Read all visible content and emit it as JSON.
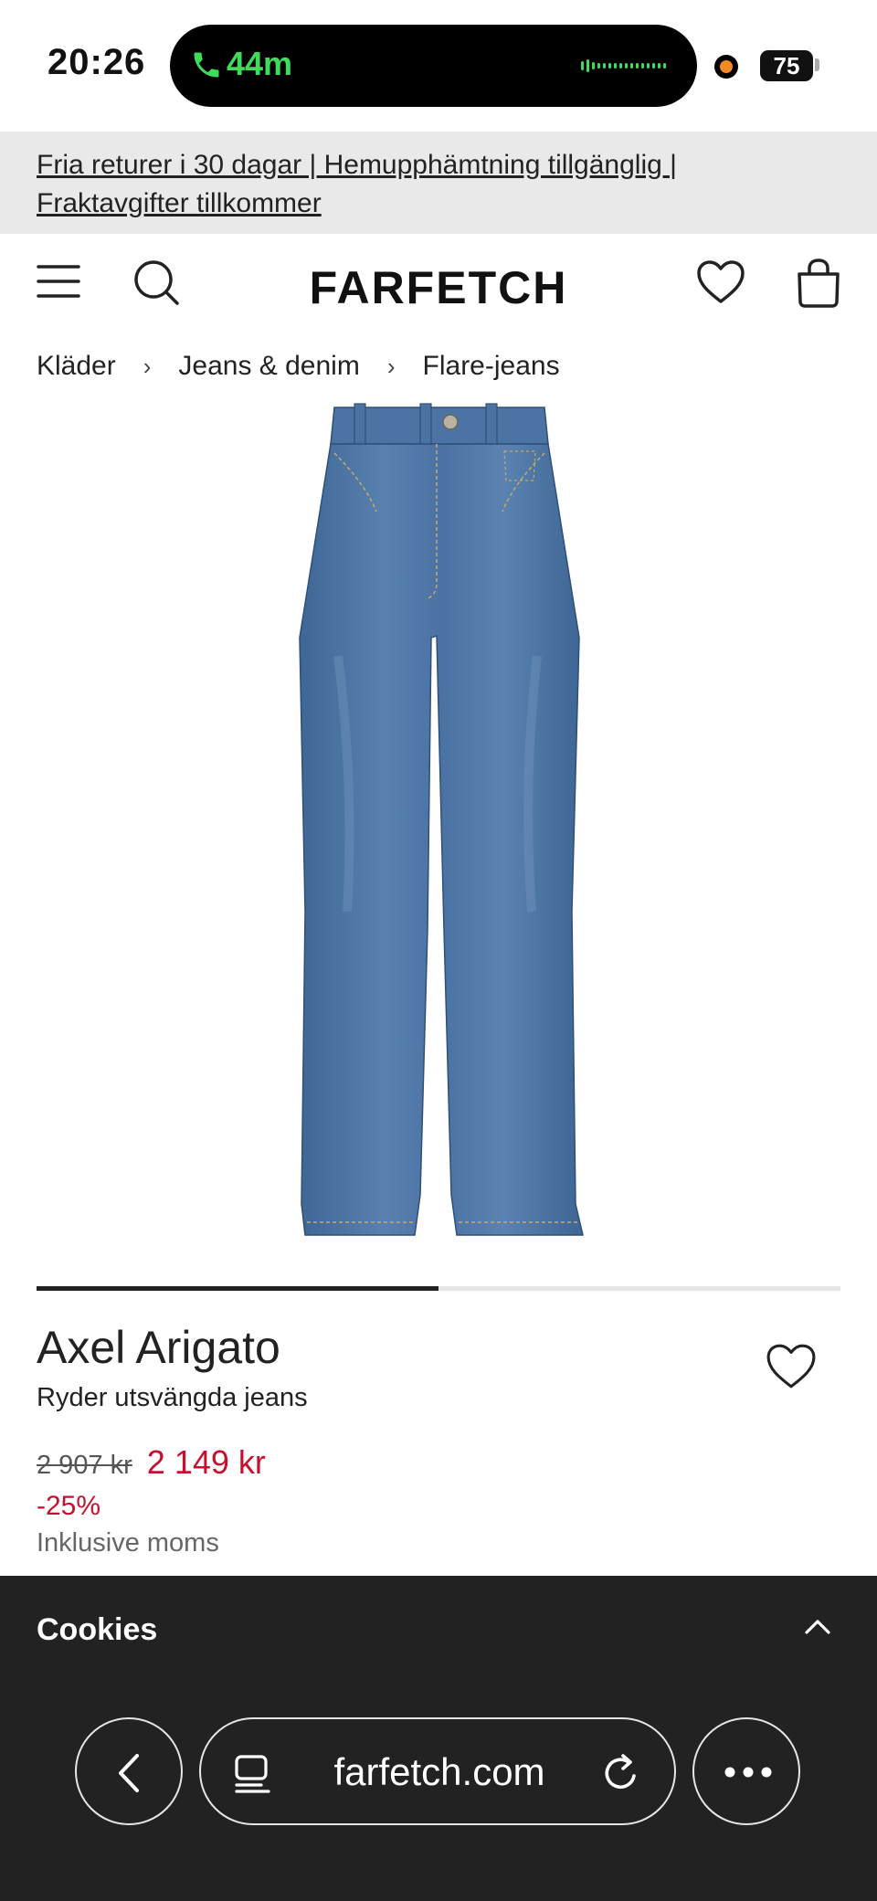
{
  "status_bar": {
    "time": "20:26",
    "call_duration": "44m",
    "battery": "75"
  },
  "promo": {
    "line1": "Fria returer i 30 dagar | Hemupphämtning tillgänglig |",
    "line2": "Fraktavgifter tillkommer"
  },
  "header": {
    "logo": "FARFETCH"
  },
  "breadcrumb": {
    "items": [
      "Kläder",
      "Jeans & denim",
      "Flare-jeans"
    ],
    "separator": "›"
  },
  "carousel": {
    "progress": 0.5
  },
  "product": {
    "brand": "Axel Arigato",
    "name": "Ryder utsvängda jeans",
    "original_price": "2 907 kr",
    "sale_price": "2 149 kr",
    "discount": "-25%",
    "vat_note": "Inklusive moms",
    "denim_color": "#4a72a3"
  },
  "cookies": {
    "title": "Cookies"
  },
  "browser": {
    "url": "farfetch.com"
  },
  "colors": {
    "sale_red": "#c8102e",
    "call_green": "#3ddc5a",
    "cookie_bg": "#222222"
  }
}
